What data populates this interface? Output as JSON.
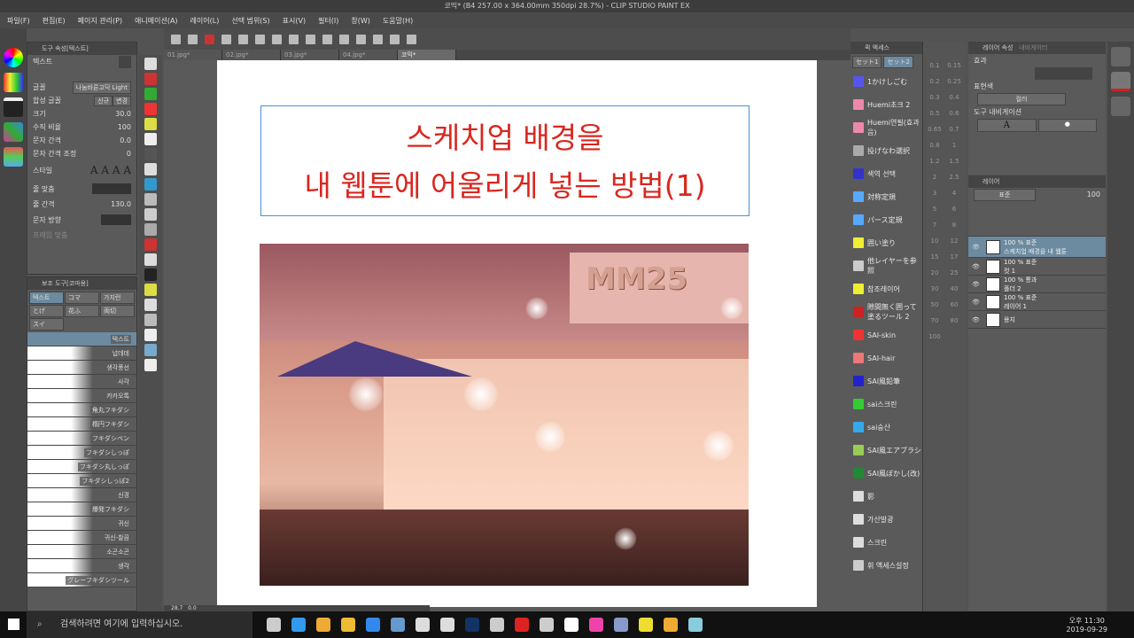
{
  "window": {
    "title": "코믹* (B4 257.00 x 364.00mm 350dpi 28.7%) - CLIP STUDIO PAINT EX"
  },
  "menu": [
    "파일(F)",
    "편집(E)",
    "페이지 관리(P)",
    "애니메이션(A)",
    "레이어(L)",
    "선택 범위(S)",
    "표시(V)",
    "필터(I)",
    "창(W)",
    "도움말(H)"
  ],
  "tabs": [
    "01.jpg*",
    "02.jpg*",
    "03.jpg*",
    "04.jpg*",
    "코믹*"
  ],
  "tool_property": {
    "header": "도구 속성[텍스트]",
    "tool": "텍스트",
    "font_label": "글꼴",
    "font_value": "나눔바른고딕 Light",
    "composite_label": "합성 글꼴",
    "new_btn": "신규",
    "change_btn": "변경",
    "size_label": "크기",
    "size": "30.0",
    "vscale_label": "수직 비율",
    "vscale": "100",
    "spacing_label": "문자 간격",
    "spacing": "0.0",
    "kerning_label": "문자 간격 조정",
    "kerning": "0",
    "style_label": "스타일",
    "align_label": "줄 맞춤",
    "linespace_label": "줄 간격",
    "linespace": "130.0",
    "direction_label": "문자 방향",
    "frame_label": "프레임 맞춤"
  },
  "subtool": {
    "header": "보조 도구[코마용]",
    "groups": [
      "텍스트",
      "コマ",
      "가지런",
      "とげ",
      "花ふ",
      "両切",
      "スイ"
    ],
    "items": [
      "텍스트",
      "넙데데",
      "생각풍선",
      "사각",
      "카카오톡",
      "角丸フキダシ",
      "楕円フキダシ",
      "フキダシペン",
      "フキダシしっぽ",
      "フキダシ丸しっぽ",
      "フキダシしっぽ2",
      "신경",
      "爆発フキダシ",
      "귀신",
      "귀신-찰끔",
      "소곤소곤",
      "생각",
      "グレーフキダシツール"
    ]
  },
  "canvas": {
    "line1": "스케치업 배경을",
    "line2": "내 웹툰에 어울리게 넣는 방법(1)",
    "sign": "MM25",
    "zoom": "28.7",
    "angle": "0.0"
  },
  "material": {
    "header": "퀵 액세스",
    "set1": "セット1",
    "set2": "セット2",
    "items": [
      "1かけしごむ",
      "Huemi초크 2",
      "Huemi연필(효과음)",
      "投げなわ選択",
      "색역 선택",
      "対称定規",
      "パース定規",
      "囲い塗り",
      "他レイヤーを参照",
      "참조레이어",
      "隙間無く囲って塗るツール 2",
      "SAI-skin",
      "SAI-hair",
      "SAI風鉛筆",
      "sai스크린",
      "sai숭산",
      "SAI風エアブラシ",
      "SAI風ぼかし(改)",
      "影",
      "가산발광",
      "스크린",
      "휘 액세스설정"
    ]
  },
  "brush_sizes": [
    "0.1",
    "0.15",
    "0.2",
    "0.25",
    "0.3",
    "0.4",
    "0.5",
    "0.6",
    "0.65",
    "0.7",
    "0.8",
    "1",
    "1.2",
    "1.5",
    "2",
    "2.5",
    "3",
    "4",
    "5",
    "6",
    "7",
    "8",
    "10",
    "12",
    "15",
    "17",
    "20",
    "25",
    "30",
    "40",
    "50",
    "60",
    "70",
    "80",
    "100"
  ],
  "layer_property": {
    "tab1": "레이어 속성",
    "tab2": "내비게이터",
    "effect_label": "효과",
    "color_label": "표현색",
    "color_value": "컬러",
    "nav_label": "도구 내비게이션"
  },
  "layers": {
    "header": "레이어",
    "blend": "표준",
    "opacity": "100",
    "items": [
      {
        "mode": "100 % 표준",
        "name": "스케치업 배경을 내 웹툰"
      },
      {
        "mode": "100 % 표준",
        "name": "컷 1"
      },
      {
        "mode": "100 % 통과",
        "name": "폴더 2"
      },
      {
        "mode": "100 % 표준",
        "name": "레이어 1"
      },
      {
        "mode": "",
        "name": "용지"
      }
    ]
  },
  "taskbar": {
    "search_placeholder": "검색하려면 여기에 입력하십시오.",
    "time": "오후 11:30",
    "date": "2019-09-29"
  }
}
